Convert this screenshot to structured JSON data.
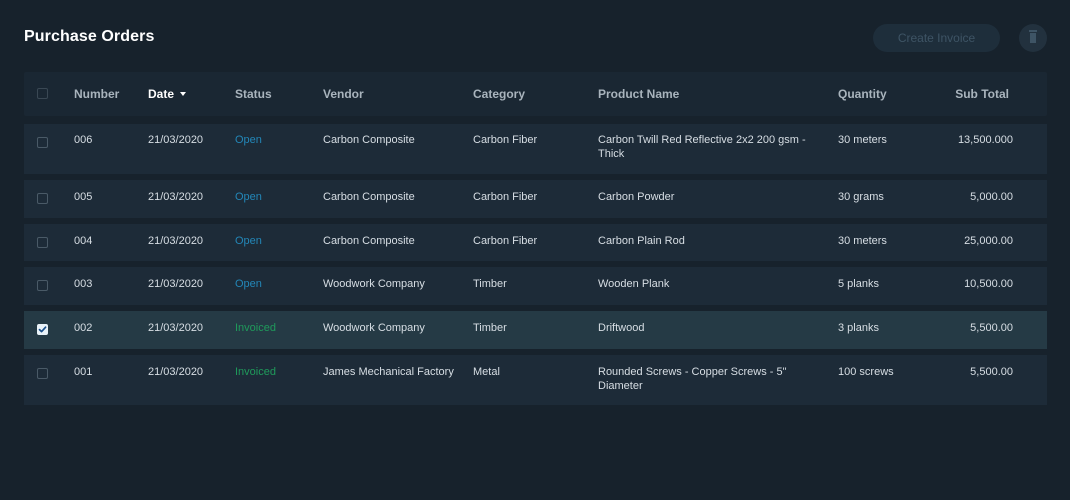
{
  "header": {
    "title": "Purchase Orders",
    "create_invoice_label": "Create Invoice",
    "delete_icon": "trash-icon"
  },
  "table": {
    "columns": {
      "number": "Number",
      "date": "Date",
      "status": "Status",
      "vendor": "Vendor",
      "category": "Category",
      "product": "Product Name",
      "quantity": "Quantity",
      "subtotal": "Sub Total"
    },
    "sorted_column": "date",
    "rows": [
      {
        "number": "006",
        "date": "21/03/2020",
        "status": "Open",
        "vendor": "Carbon Composite",
        "category": "Carbon Fiber",
        "product": "Carbon Twill Red Reflective 2x2 200 gsm - Thick",
        "quantity": "30 meters",
        "subtotal": "13,500.000",
        "checked": false
      },
      {
        "number": "005",
        "date": "21/03/2020",
        "status": "Open",
        "vendor": "Carbon Composite",
        "category": "Carbon Fiber",
        "product": "Carbon Powder",
        "quantity": "30 grams",
        "subtotal": "5,000.00",
        "checked": false
      },
      {
        "number": "004",
        "date": "21/03/2020",
        "status": "Open",
        "vendor": "Carbon Composite",
        "category": "Carbon Fiber",
        "product": "Carbon Plain Rod",
        "quantity": "30 meters",
        "subtotal": "25,000.00",
        "checked": false
      },
      {
        "number": "003",
        "date": "21/03/2020",
        "status": "Open",
        "vendor": "Woodwork Company",
        "category": "Timber",
        "product": "Wooden Plank",
        "quantity": "5 planks",
        "subtotal": "10,500.00",
        "checked": false
      },
      {
        "number": "002",
        "date": "21/03/2020",
        "status": "Invoiced",
        "vendor": "Woodwork Company",
        "category": "Timber",
        "product": "Driftwood",
        "quantity": "3 planks",
        "subtotal": "5,500.00",
        "checked": true
      },
      {
        "number": "001",
        "date": "21/03/2020",
        "status": "Invoiced",
        "vendor": "James Mechanical Factory",
        "category": "Metal",
        "product": "Rounded Screws - Copper Screws - 5\" Diameter",
        "quantity": "100 screws",
        "subtotal": "5,500.00",
        "checked": false
      }
    ]
  },
  "colors": {
    "background": "#17222c",
    "row": "#1d2b38",
    "row_selected": "#253a45",
    "status_open": "#2387b8",
    "status_invoiced": "#1f9a5b"
  }
}
